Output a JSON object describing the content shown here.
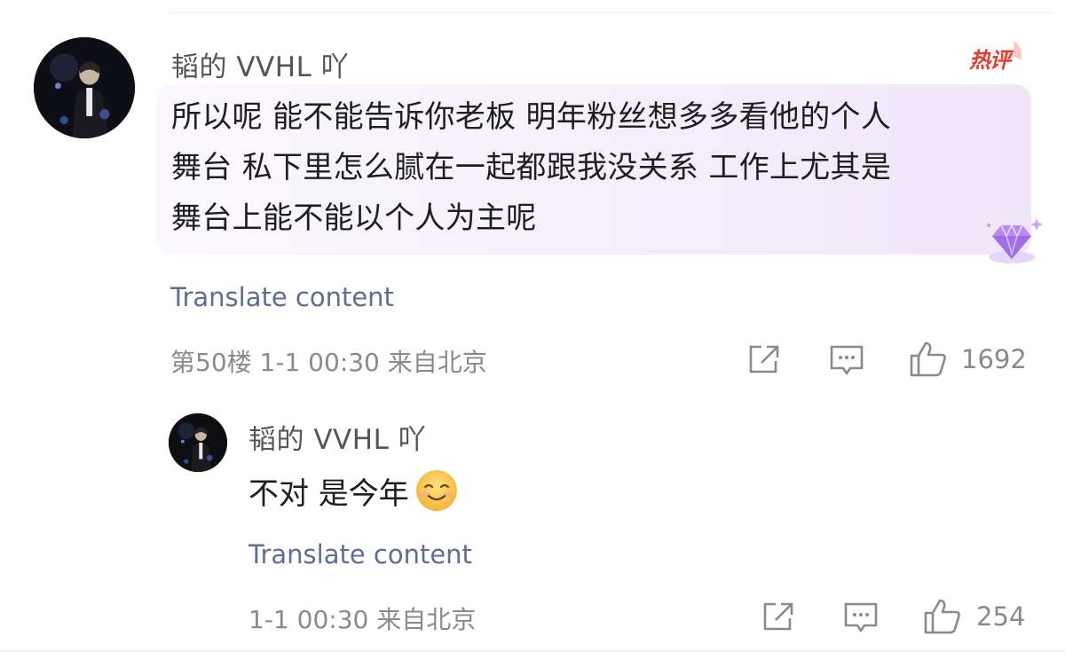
{
  "comment": {
    "username": "韬的 VVHL 吖",
    "hot_badge": "热评",
    "lines": [
      "所以呢 能不能告诉你老板 明年粉丝想多多看他的个人",
      "舞台 私下里怎么腻在一起都跟我没关系 工作上尤其是",
      "舞台上能不能以个人为主呢"
    ],
    "translate_label": "Translate content",
    "meta": "第50楼 1-1 00:30 来自北京",
    "like_count": "1692",
    "icons": {
      "share": "share-icon",
      "reply": "comment-icon",
      "like": "thumbs-up-icon",
      "badge": "gem-icon"
    }
  },
  "reply": {
    "username": "韬的 VVHL 吖",
    "text": "不对 是今年",
    "emoji": "smiling-face-emoji",
    "translate_label": "Translate content",
    "meta": "1-1 00:30 来自北京",
    "like_count": "254"
  },
  "colors": {
    "link": "#5b6e93",
    "meta": "#8a8a8a",
    "hot_badge": "#e8392d",
    "bubble": "#f4eefa"
  }
}
